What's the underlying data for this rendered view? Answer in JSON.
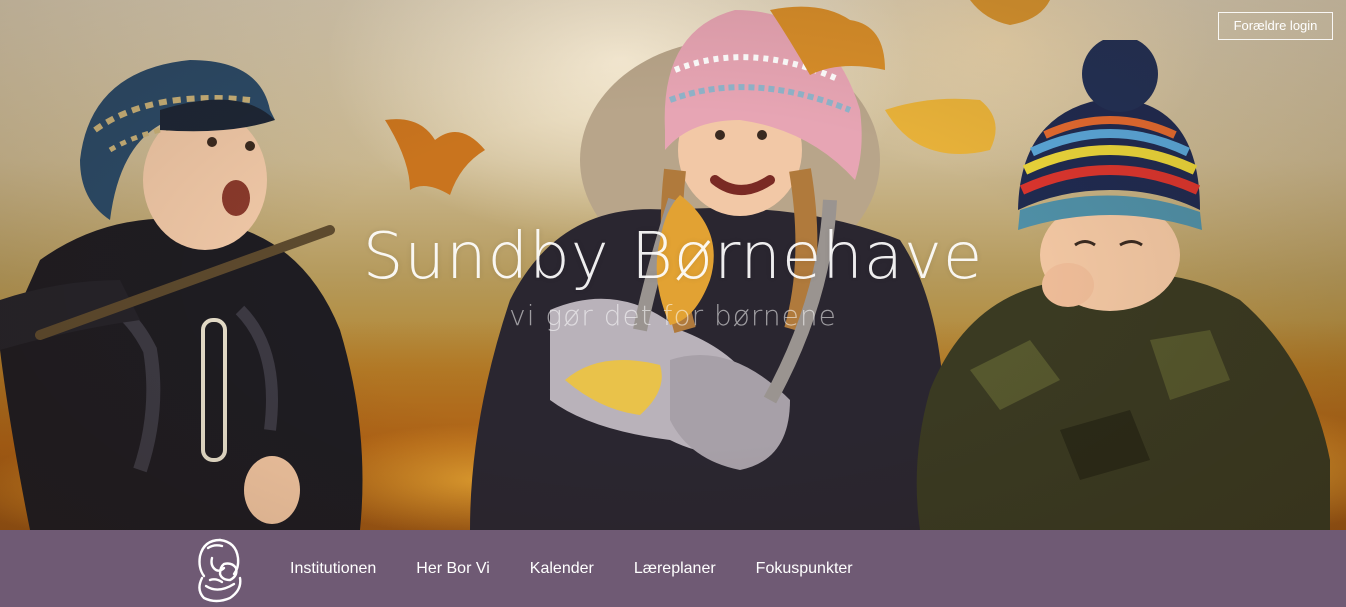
{
  "hero": {
    "title": "Sundby Børnehave",
    "subtitle": "vi gør det for børnene"
  },
  "header": {
    "login_label": "Forældre login"
  },
  "nav": {
    "logo_icon": "mother-child-logo-icon",
    "items": [
      {
        "label": "Institutionen"
      },
      {
        "label": "Her Bor Vi"
      },
      {
        "label": "Kalender"
      },
      {
        "label": "Læreplaner"
      },
      {
        "label": "Fokuspunkter"
      }
    ]
  },
  "colors": {
    "nav_background": "#6f5a74",
    "text": "#ffffff"
  }
}
